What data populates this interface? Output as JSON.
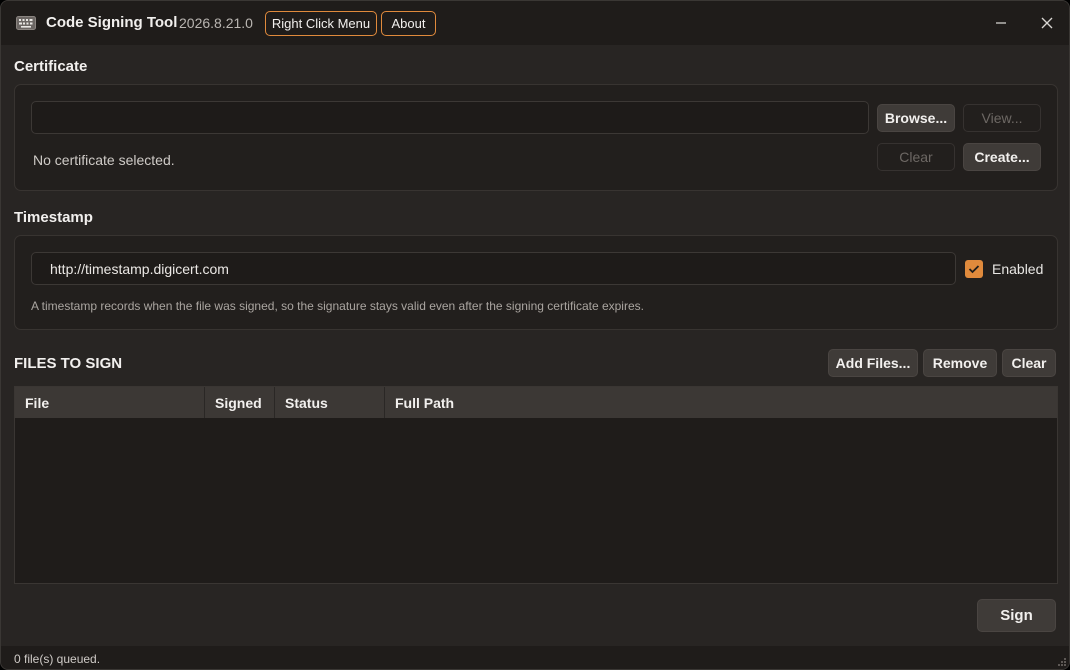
{
  "app": {
    "title": "Code Signing Tool",
    "version": "2026.8.21.0",
    "icon": "keyboard-icon",
    "accent": "#e08a3c"
  },
  "header_buttons": {
    "right_click_menu": "Right Click Menu",
    "about": "About"
  },
  "certificate": {
    "section_title": "Certificate",
    "path_value": "",
    "status": "No certificate selected.",
    "browse": "Browse...",
    "view": "View...",
    "clear": "Clear",
    "create": "Create..."
  },
  "timestamp": {
    "section_title": "Timestamp",
    "url": "http://timestamp.digicert.com",
    "enabled_label": "Enabled",
    "enabled": true,
    "hint": "A timestamp records when the file was signed, so the signature stays valid even after the signing certificate expires."
  },
  "files": {
    "section_title": "FILES TO SIGN",
    "add_files": "Add Files...",
    "remove": "Remove",
    "clear": "Clear",
    "columns": [
      "File",
      "Signed",
      "Status",
      "Full Path"
    ],
    "rows": []
  },
  "actions": {
    "sign": "Sign"
  },
  "status_bar": {
    "text": "0 file(s) queued."
  }
}
